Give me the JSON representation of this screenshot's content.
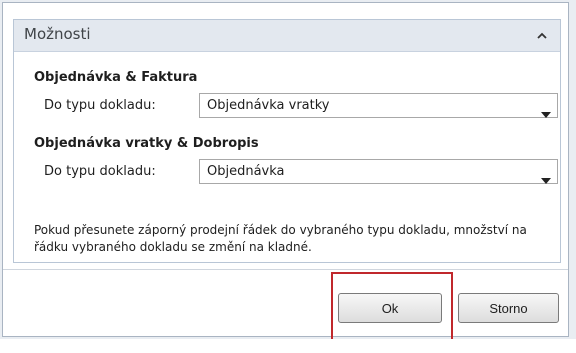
{
  "panel": {
    "title": "Možnosti",
    "collapse_icon": "chevron-up-icon"
  },
  "groups": [
    {
      "title": "Objednávka & Faktura",
      "field_label": "Do typu dokladu:",
      "selected": "Objednávka vratky"
    },
    {
      "title": "Objednávka vratky & Dobropis",
      "field_label": "Do typu dokladu:",
      "selected": "Objednávka"
    }
  ],
  "info_text": "Pokud přesunete záporný prodejní řádek do vybraného typu dokladu, množství na řádku vybraného dokladu se změní na kladné.",
  "buttons": {
    "ok_label": "Ok",
    "cancel_label": "Storno"
  },
  "colors": {
    "highlight": "#c0282c",
    "panel_header": "#e3e8ef"
  }
}
